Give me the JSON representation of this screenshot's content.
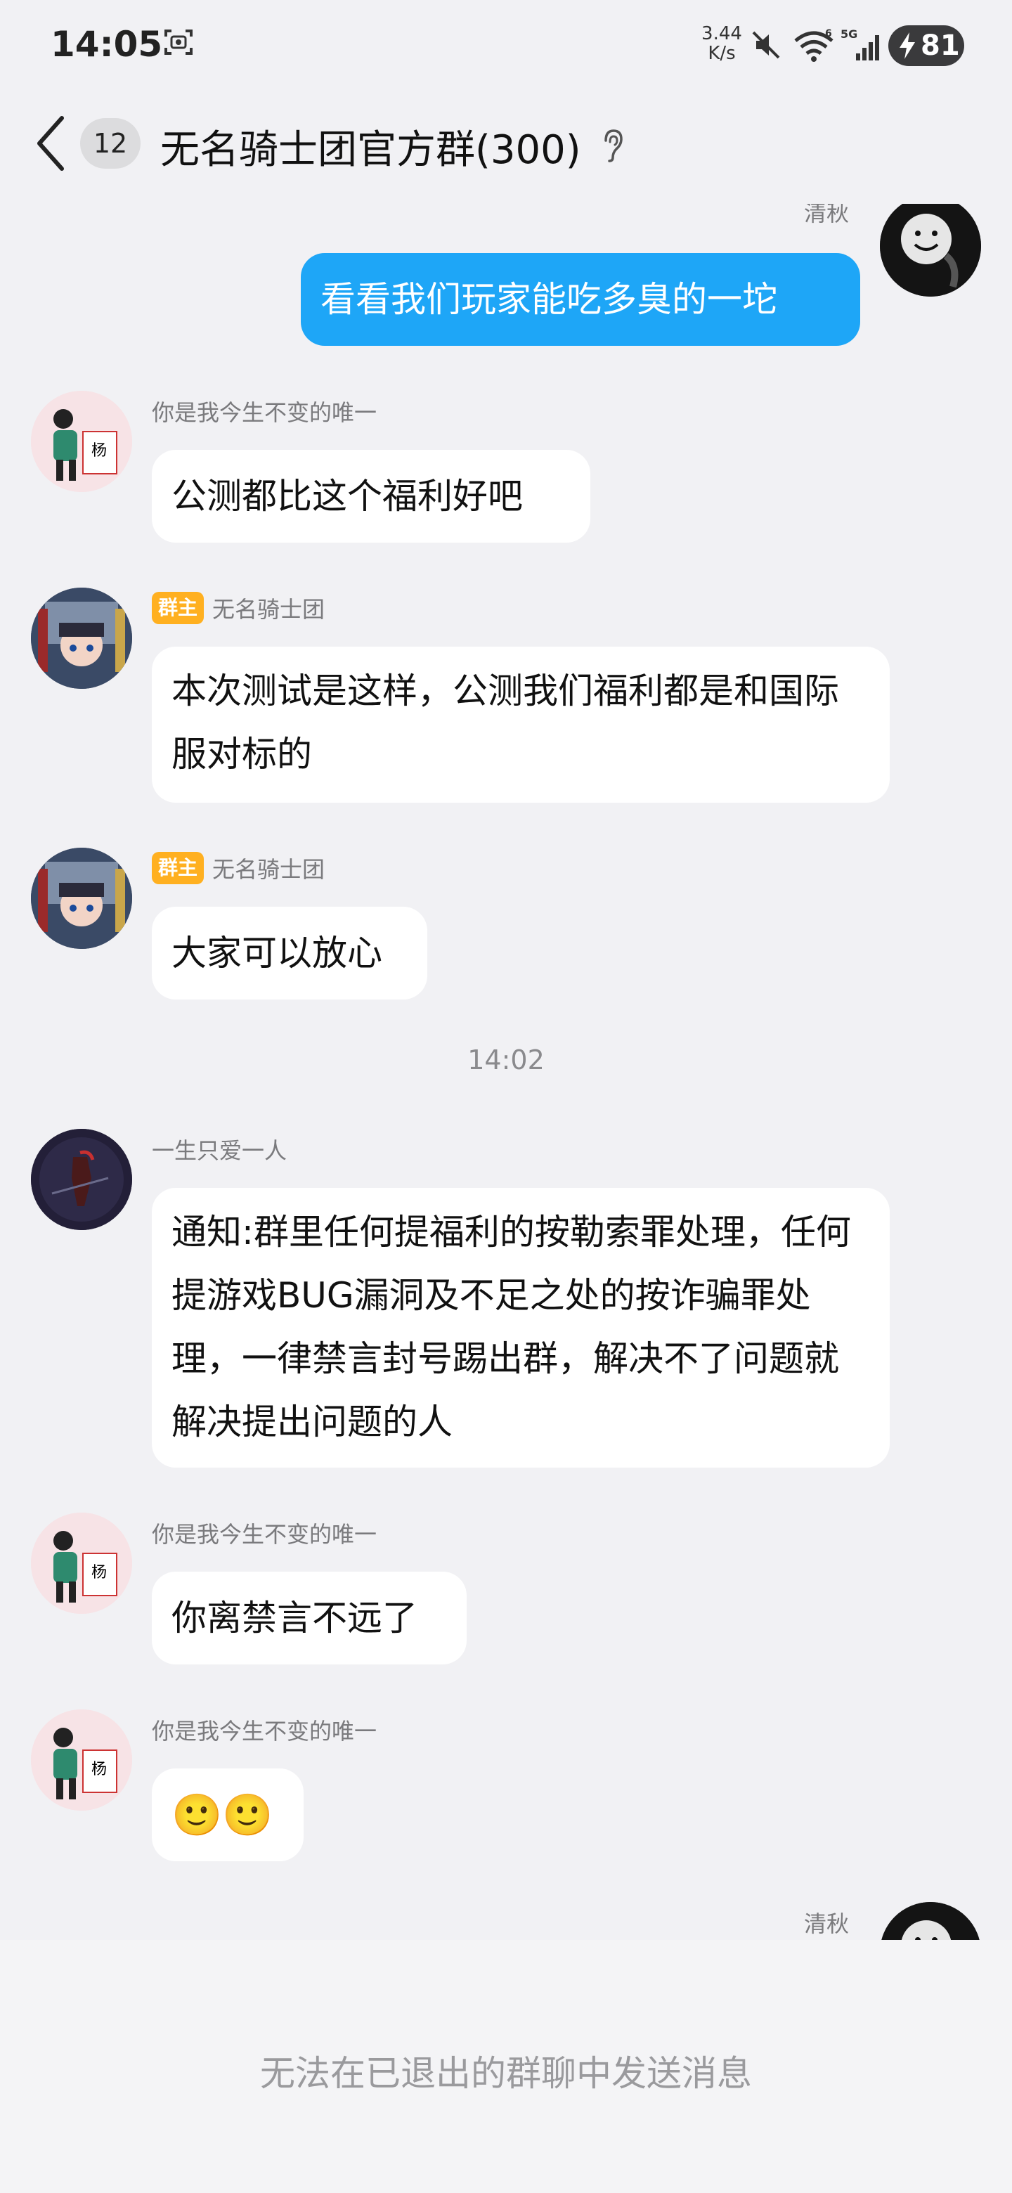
{
  "status_bar": {
    "time": "14:05",
    "net_speed_value": "3.44",
    "net_speed_unit": "K/s",
    "network_type": "5G",
    "battery": "81"
  },
  "header": {
    "unread_count": "12",
    "title": "无名骑士团官方群(300)"
  },
  "messages": [
    {
      "sender": "清秋",
      "text": "看看我们玩家能吃多臭的一坨",
      "mine": true
    },
    {
      "sender": "你是我今生不变的唯一",
      "text": "公测都比这个福利好吧"
    },
    {
      "sender": "无名骑士团",
      "badge": "群主",
      "text": "本次测试是这样，公测我们福利都是和国际服对标的"
    },
    {
      "sender": "无名骑士团",
      "badge": "群主",
      "text": "大家可以放心"
    },
    {
      "timestamp": "14:02"
    },
    {
      "sender": "一生只爱一人",
      "text": "通知:群里任何提福利的按勒索罪处理，任何提游戏BUG漏洞及不足之处的按诈骗罪处理，一律禁言封号踢出群，解决不了问题就解决提出问题的人"
    },
    {
      "sender": "你是我今生不变的唯一",
      "text": "你离禁言不远了"
    },
    {
      "sender": "你是我今生不变的唯一",
      "text": "🙂🙂"
    },
    {
      "sender": "清秋",
      "mine": true
    }
  ],
  "footer": {
    "notice": "无法在已退出的群聊中发送消息"
  },
  "colors": {
    "background": "#f1f1f4",
    "my_bubble": "#1ea6f7",
    "owner_badge": "#ffb020"
  }
}
